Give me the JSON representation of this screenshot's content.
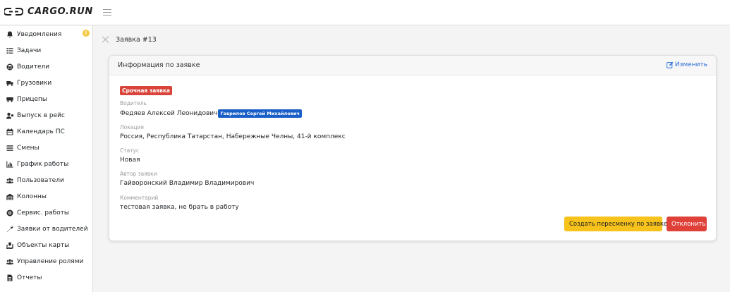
{
  "app": {
    "brand": "CARGO.RUN"
  },
  "sidebar": {
    "notification_count": "!",
    "items": [
      {
        "label": "Уведомления",
        "icon": "bell-icon"
      },
      {
        "label": "Задачи",
        "icon": "list-icon"
      },
      {
        "label": "Водители",
        "icon": "steering-wheel-icon"
      },
      {
        "label": "Грузовики",
        "icon": "truck-icon"
      },
      {
        "label": "Прицепы",
        "icon": "trailer-icon"
      },
      {
        "label": "Выпуск в рейс",
        "icon": "user-check-icon"
      },
      {
        "label": "Календарь ПС",
        "icon": "calendar-icon"
      },
      {
        "label": "Смены",
        "icon": "bars-icon"
      },
      {
        "label": "График работы",
        "icon": "chart-icon"
      },
      {
        "label": "Пользователи",
        "icon": "users-icon"
      },
      {
        "label": "Колонны",
        "icon": "warehouse-icon"
      },
      {
        "label": "Сервис. работы",
        "icon": "cog-icon"
      },
      {
        "label": "Заявки от водителей",
        "icon": "wrench-icon"
      },
      {
        "label": "Объекты карты",
        "icon": "map-icon"
      },
      {
        "label": "Управление ролями",
        "icon": "users-cog-icon"
      },
      {
        "label": "Отчеты",
        "icon": "file-icon"
      }
    ]
  },
  "breadcrumb": {
    "title": "Заявка #13"
  },
  "card": {
    "header": "Информация по заявке",
    "edit_label": "Изменить",
    "urgent_badge": "Срочная заявка",
    "fields": {
      "driver_label": "Водитель",
      "driver_value": "Федяев Алексей Леонидович",
      "driver_badge": "Гаврилов Сергей Михайлович",
      "location_label": "Локация",
      "location_value": "Россия, Республика Татарстан, Набережные Челны, 41-й комплекс",
      "status_label": "Статус",
      "status_value": "Новая",
      "author_label": "Автор заявки",
      "author_value": "Гайворонский Владимир Владимирович",
      "comment_label": "Комментарий",
      "comment_value": "тестовая заявка, не брать в работу"
    },
    "buttons": {
      "create_shift": "Создать пересменку по заявке",
      "reject": "Отклонить"
    }
  },
  "colors": {
    "accent_blue": "#2c6fd6",
    "urgent_red": "#d9443a",
    "warning_yellow": "#f6c21b",
    "reject_red": "#df4139",
    "driver_badge_blue": "#1a5fc7"
  }
}
